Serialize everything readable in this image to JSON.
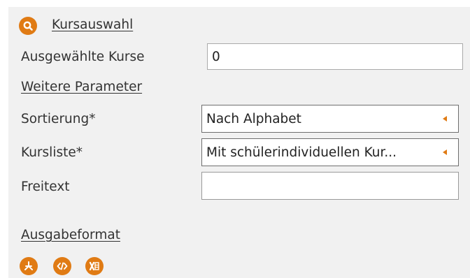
{
  "course_selection": {
    "link_label": "Kursauswahl",
    "icon": "search-icon"
  },
  "selected_courses": {
    "label": "Ausgewählte Kurse",
    "value": "0"
  },
  "more_params": {
    "link_label": "Weitere Parameter"
  },
  "sorting": {
    "label": "Sortierung*",
    "value": "Nach Alphabet"
  },
  "course_list": {
    "label": "Kursliste*",
    "value": "Mit schülerindividuellen Kur..."
  },
  "free_text": {
    "label": "Freitext",
    "value": ""
  },
  "output_format": {
    "label": "Ausgabeformat",
    "icons": [
      "pdf-icon",
      "html-code-icon",
      "excel-icon"
    ]
  },
  "colors": {
    "accent": "#e07b14",
    "panel_bg": "#f1f1f1"
  }
}
